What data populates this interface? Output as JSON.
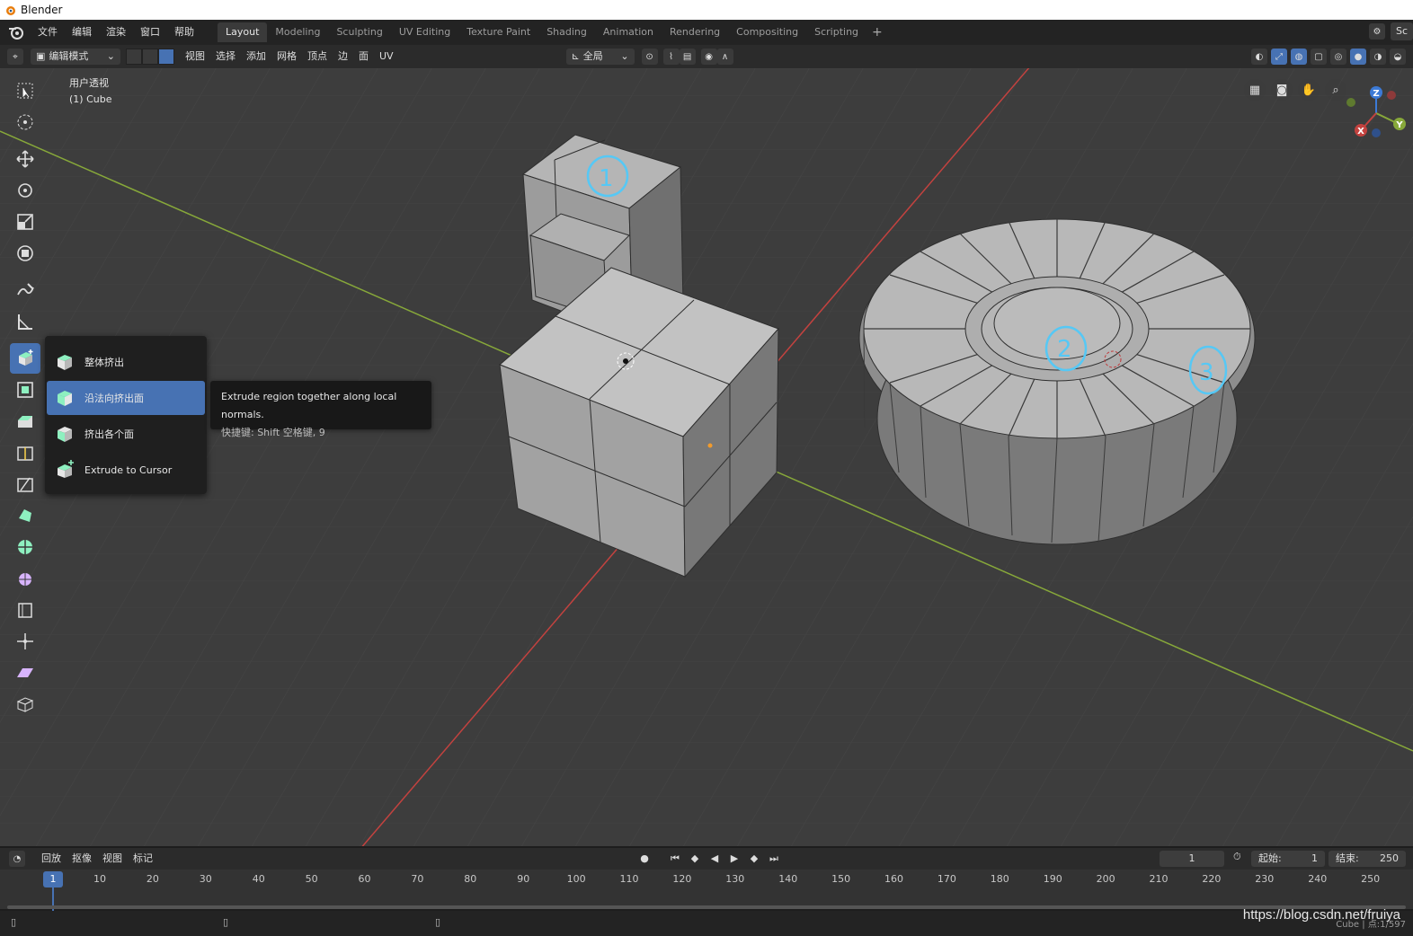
{
  "window": {
    "title": "Blender"
  },
  "menu": {
    "items": [
      "文件",
      "编辑",
      "渲染",
      "窗口",
      "帮助"
    ]
  },
  "workspaces": {
    "tabs": [
      "Layout",
      "Modeling",
      "Sculpting",
      "UV Editing",
      "Texture Paint",
      "Shading",
      "Animation",
      "Rendering",
      "Compositing",
      "Scripting"
    ],
    "active": "Layout",
    "add_label": "+"
  },
  "scene_label": "Sc",
  "viewport_header": {
    "mode": "编辑模式",
    "menus": [
      "视图",
      "选择",
      "添加",
      "网格",
      "顶点",
      "边",
      "面",
      "UV"
    ],
    "transform_orientation": "全局"
  },
  "viewport": {
    "view_name": "用户透视",
    "object_name": "(1) Cube",
    "annotations": [
      "1",
      "2",
      "3"
    ],
    "gizmo_axes": {
      "x": "X",
      "y": "Y",
      "z": "Z"
    }
  },
  "extrude_menu": {
    "items": [
      {
        "label": "整体挤出",
        "icon": "extrude-region-icon"
      },
      {
        "label": "沿法向挤出面",
        "icon": "extrude-along-normals-icon"
      },
      {
        "label": "挤出各个面",
        "icon": "extrude-individual-icon"
      },
      {
        "label": "Extrude to Cursor",
        "icon": "extrude-to-cursor-icon"
      }
    ],
    "highlighted_index": 1
  },
  "tooltip": {
    "description": "Extrude region together along local normals.",
    "shortcut": "快捷键: Shift 空格键, 9"
  },
  "timeline": {
    "menus": [
      "回放",
      "抠像",
      "视图",
      "标记"
    ],
    "current_frame": "1",
    "start_label": "起始:",
    "start_value": "1",
    "end_label": "结束:",
    "end_value": "250",
    "ruler": [
      "1",
      "10",
      "20",
      "30",
      "40",
      "50",
      "60",
      "70",
      "80",
      "90",
      "100",
      "110",
      "120",
      "130",
      "140",
      "150",
      "160",
      "170",
      "180",
      "190",
      "200",
      "210",
      "220",
      "230",
      "240",
      "250"
    ]
  },
  "statusbar": {
    "info": "Cube | 点:1/597"
  },
  "watermark": "https://blog.csdn.net/fruiya",
  "colors": {
    "accent": "#4772b3",
    "viewport_bg": "#3d3d3d",
    "x_axis": "#c3423f",
    "y_axis": "#87a83a",
    "annotation": "#56c8f5"
  }
}
